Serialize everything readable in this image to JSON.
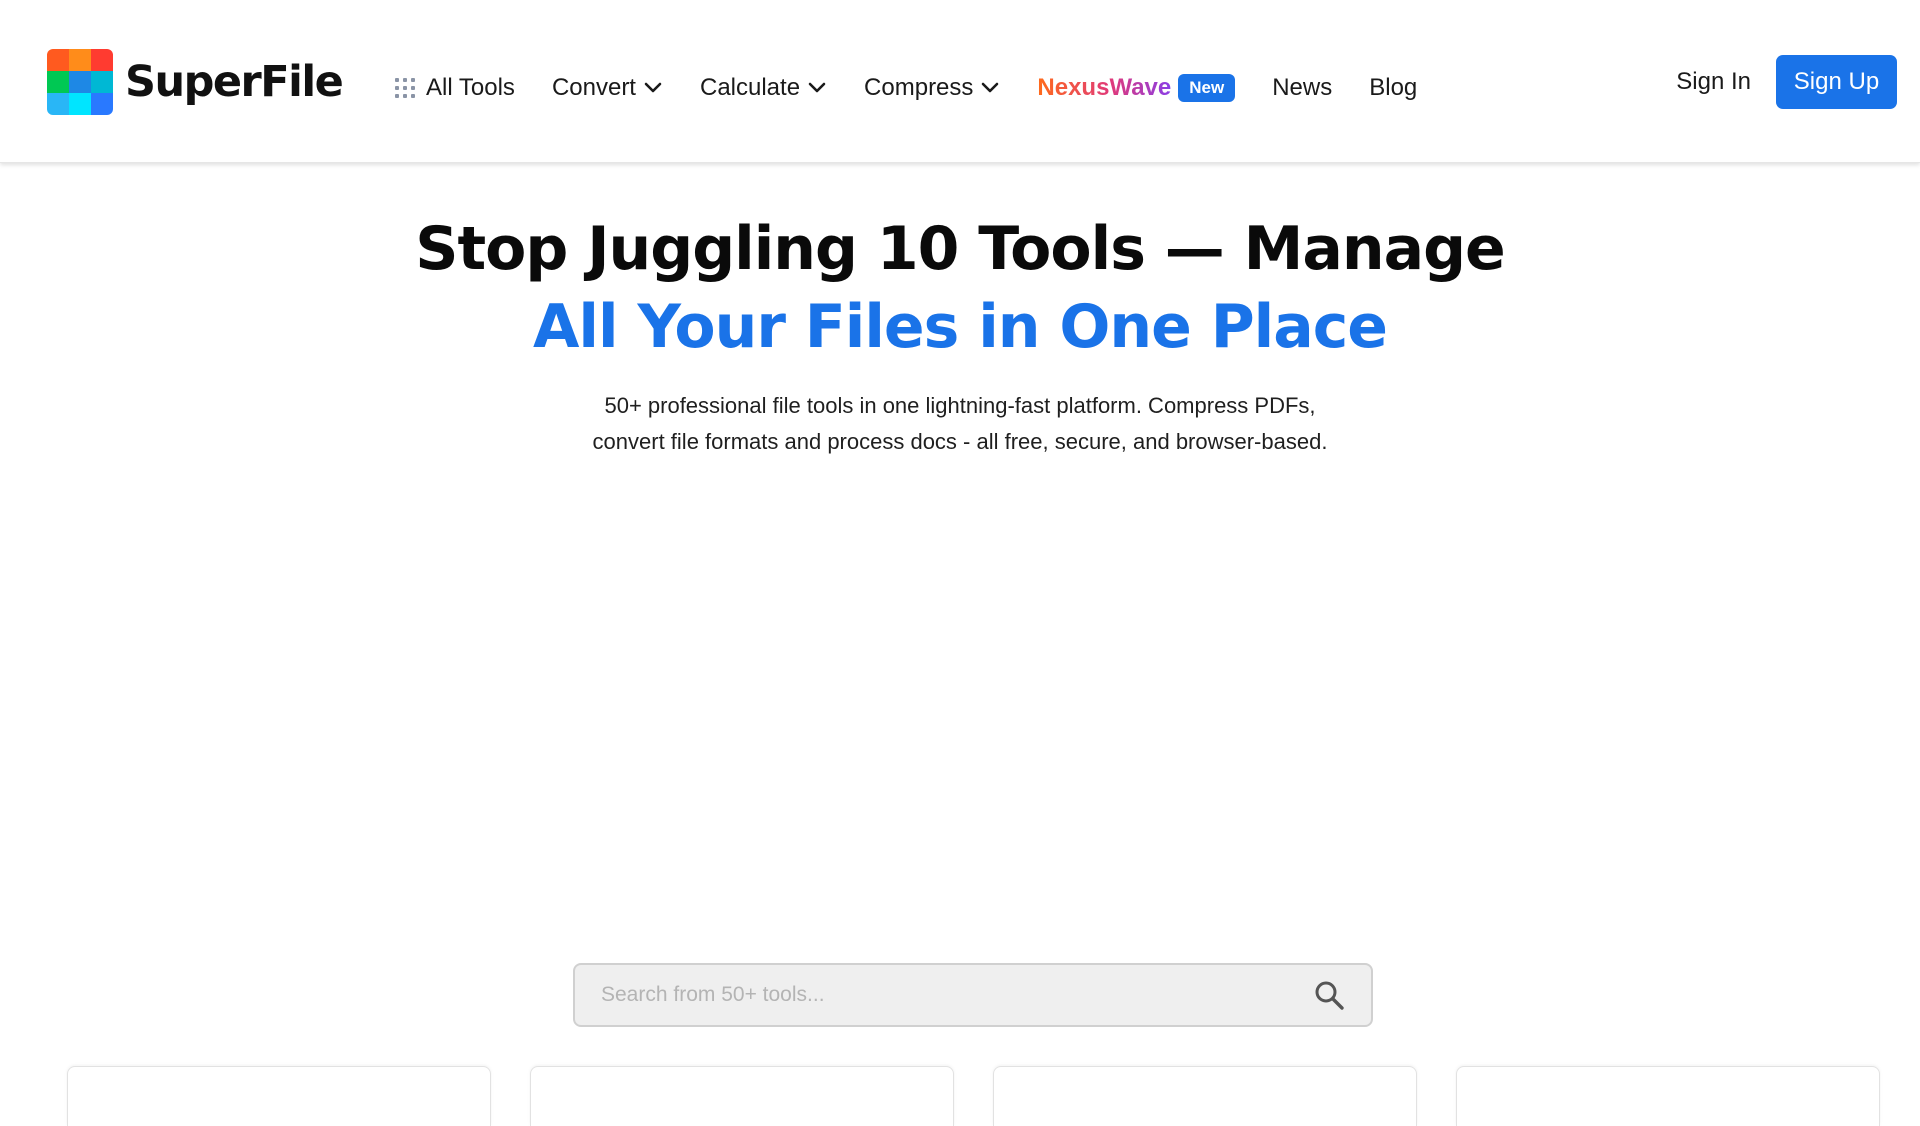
{
  "brand": {
    "name": "SuperFile",
    "logo_colors": [
      "#ff5a1f",
      "#ff8c1a",
      "#ff3b30",
      "#00c853",
      "#1e88e5",
      "#00b8d4",
      "#29b6f6",
      "#00e5ff",
      "#2979ff"
    ]
  },
  "nav": {
    "all_tools": "All Tools",
    "convert": "Convert",
    "calculate": "Calculate",
    "compress": "Compress",
    "nexuswave": "NexusWave",
    "new_badge": "New",
    "news": "News",
    "blog": "Blog"
  },
  "auth": {
    "sign_in": "Sign In",
    "sign_up": "Sign Up"
  },
  "hero": {
    "title_line1": "Stop Juggling 10 Tools — Manage",
    "title_line2": "All Your Files in One Place",
    "subtitle_line1": "50+ professional file tools in one lightning-fast platform. Compress PDFs,",
    "subtitle_line2": "convert file formats and process docs - all free, secure, and browser-based."
  },
  "search": {
    "placeholder": "Search from 50+ tools..."
  },
  "colors": {
    "accent": "#1a73e8",
    "nexus_gradient_start": "#ff6b1a",
    "nexus_gradient_end": "#8a3ee6"
  }
}
